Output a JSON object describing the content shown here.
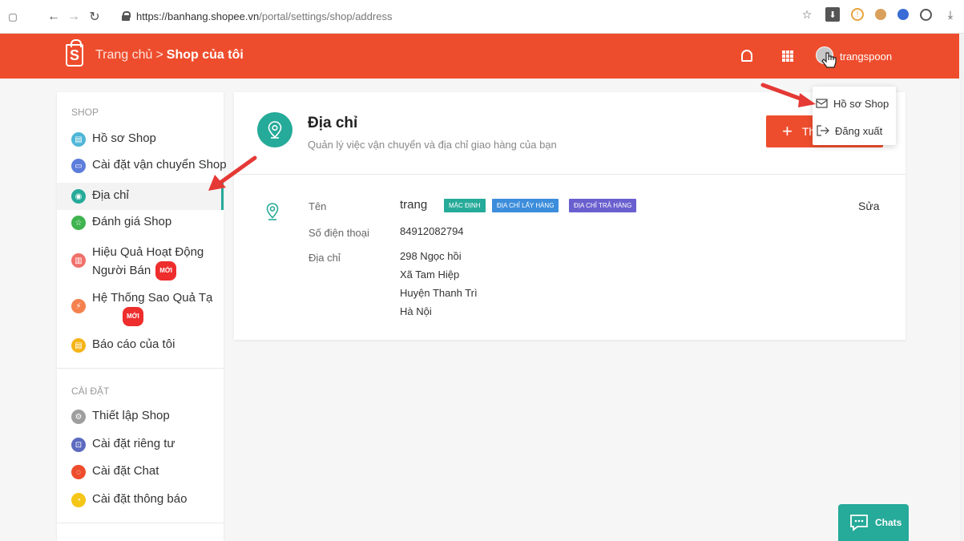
{
  "browser": {
    "url_host": "https://banhang.shopee.vn",
    "url_path": "/portal/settings/shop/address"
  },
  "header": {
    "crumb_home": "Trang chủ",
    "crumb_sep": ">",
    "crumb_current": "Shop của tôi",
    "username": "trangspoon",
    "logo_letter": "S"
  },
  "sidebar": {
    "shop_section": "SHOP",
    "settings_section": "CÀI ĐẶT",
    "new_badge": "MỚI",
    "shop_items": [
      {
        "label": "Hồ sơ Shop",
        "icon": "profile-icon",
        "color": "#4fb6d7"
      },
      {
        "label": "Cài đặt vận chuyển Shop",
        "icon": "truck-icon",
        "color": "#5c7ddb"
      },
      {
        "label": "Địa chỉ",
        "icon": "location-pin-icon",
        "color": "#26aa99"
      },
      {
        "label": "Đánh giá Shop",
        "icon": "star-icon",
        "color": "#3fb34f"
      },
      {
        "label_line1": "Hiệu Quả Hoạt Động",
        "label_line2": "Người Bán",
        "icon": "chart-icon",
        "color": "#f0706a"
      },
      {
        "label_line1": "Hệ Thống Sao Quả Tạ",
        "icon": "bolt-icon",
        "color": "#f5814e"
      },
      {
        "label": "Báo cáo của tôi",
        "icon": "report-icon",
        "color": "#f5b417"
      }
    ],
    "settings_items": [
      {
        "label": "Thiết lập Shop",
        "icon": "gear-icon",
        "color": "#9e9e9e"
      },
      {
        "label": "Cài đặt riêng tư",
        "icon": "lock-icon",
        "color": "#5c6bc0"
      },
      {
        "label": "Cài đặt Chat",
        "icon": "chat-icon",
        "color": "#ee4d2d"
      },
      {
        "label": "Cài đặt thông báo",
        "icon": "bell-icon",
        "color": "#f5c518"
      }
    ]
  },
  "main": {
    "title": "Địa chỉ",
    "subtitle": "Quản lý việc vận chuyển và địa chỉ giao hàng của bạn",
    "add_button": "Th",
    "address": {
      "name_label": "Tên",
      "name": "trang",
      "tags": [
        {
          "text": "MẶC ĐỊNH",
          "color": "#26aa99"
        },
        {
          "text": "ĐỊA CHỈ LẤY HÀNG",
          "color": "#3c8ddb"
        },
        {
          "text": "ĐỊA CHỈ TRẢ HÀNG",
          "color": "#6a5fcf"
        }
      ],
      "phone_label": "Số điện thoại",
      "phone": "84912082794",
      "address_label": "Địa chỉ",
      "line1": "298 Ngọc hồi",
      "line2": "Xã Tam Hiệp",
      "line3": "Huyện Thanh Trì",
      "line4": "Hà Nội",
      "edit": "Sửa"
    }
  },
  "dropdown": {
    "profile": "Hồ sơ Shop",
    "logout": "Đăng xuất"
  },
  "chats": {
    "label": "Chats"
  },
  "colors": {
    "brand": "#ee4d2d",
    "accent": "#26aa99",
    "annotation_arrow": "#e53935"
  }
}
